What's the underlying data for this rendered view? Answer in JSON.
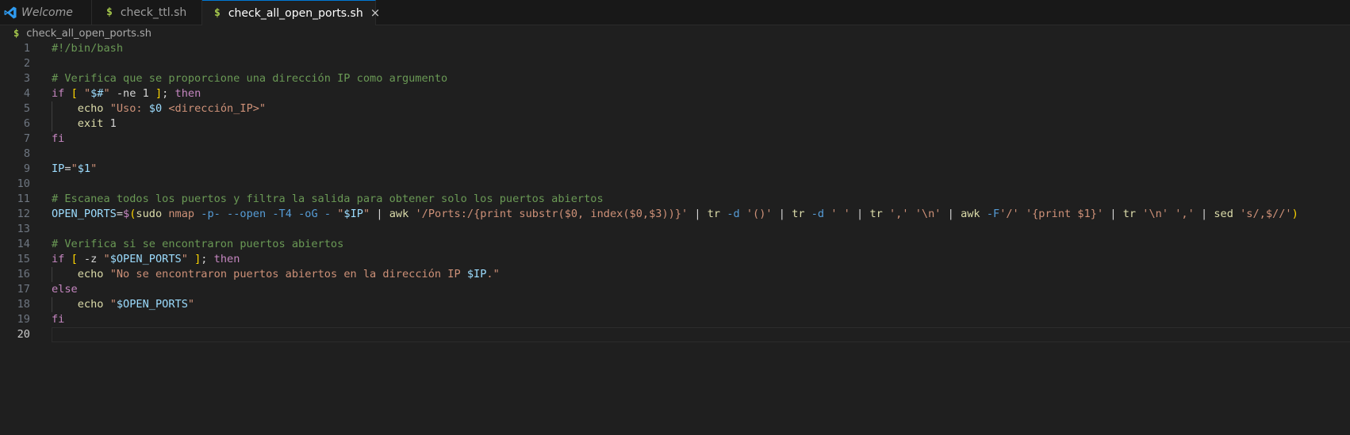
{
  "tabs": [
    {
      "label": "Welcome",
      "icon": "vscode-icon",
      "active": false
    },
    {
      "label": "check_ttl.sh",
      "icon": "dollar-icon",
      "active": false
    },
    {
      "label": "check_all_open_ports.sh",
      "icon": "dollar-icon",
      "active": true
    }
  ],
  "tab_icon_glyph": "$",
  "close_glyph": "×",
  "breadcrumb": {
    "file": "check_all_open_ports.sh",
    "icon": "dollar-icon",
    "glyph": "$"
  },
  "code_lines": [
    {
      "n": "1",
      "tokens": [
        [
          "c",
          "#!/bin/bash"
        ]
      ]
    },
    {
      "n": "2",
      "tokens": []
    },
    {
      "n": "3",
      "tokens": [
        [
          "c",
          "# Verifica que se proporcione una dirección IP como argumento"
        ]
      ]
    },
    {
      "n": "4",
      "tokens": [
        [
          "k",
          "if"
        ],
        [
          "p",
          " "
        ],
        [
          "b1",
          "["
        ],
        [
          "p",
          " "
        ],
        [
          "s",
          "\""
        ],
        [
          "v",
          "$#"
        ],
        [
          "s",
          "\""
        ],
        [
          "p",
          " -ne 1 "
        ],
        [
          "b1",
          "]"
        ],
        [
          "p",
          "; "
        ],
        [
          "k",
          "then"
        ]
      ]
    },
    {
      "n": "5",
      "guide": true,
      "tokens": [
        [
          "p",
          "    "
        ],
        [
          "f",
          "echo"
        ],
        [
          "p",
          " "
        ],
        [
          "s",
          "\"Uso: "
        ],
        [
          "v",
          "$0"
        ],
        [
          "s",
          " <dirección_IP>\""
        ]
      ]
    },
    {
      "n": "6",
      "guide": true,
      "tokens": [
        [
          "p",
          "    "
        ],
        [
          "f",
          "exit"
        ],
        [
          "p",
          " 1"
        ]
      ]
    },
    {
      "n": "7",
      "tokens": [
        [
          "k",
          "fi"
        ]
      ]
    },
    {
      "n": "8",
      "tokens": []
    },
    {
      "n": "9",
      "tokens": [
        [
          "v",
          "IP"
        ],
        [
          "p",
          "="
        ],
        [
          "s",
          "\""
        ],
        [
          "v",
          "$1"
        ],
        [
          "s",
          "\""
        ]
      ]
    },
    {
      "n": "10",
      "tokens": []
    },
    {
      "n": "11",
      "tokens": [
        [
          "c",
          "# Escanea todos los puertos y filtra la salida para obtener solo los puertos abiertos"
        ]
      ]
    },
    {
      "n": "12",
      "tokens": [
        [
          "v",
          "OPEN_PORTS"
        ],
        [
          "p",
          "="
        ],
        [
          "k",
          "$"
        ],
        [
          "b1",
          "("
        ],
        [
          "f",
          "sudo"
        ],
        [
          "p",
          " "
        ],
        [
          "s",
          "nmap"
        ],
        [
          "p",
          " "
        ],
        [
          "o",
          "-p-"
        ],
        [
          "p",
          " "
        ],
        [
          "o",
          "--open"
        ],
        [
          "p",
          " "
        ],
        [
          "o",
          "-T4"
        ],
        [
          "p",
          " "
        ],
        [
          "o",
          "-oG"
        ],
        [
          "p",
          " "
        ],
        [
          "o",
          "-"
        ],
        [
          "p",
          " "
        ],
        [
          "s",
          "\""
        ],
        [
          "v",
          "$IP"
        ],
        [
          "s",
          "\""
        ],
        [
          "p",
          " | "
        ],
        [
          "f",
          "awk"
        ],
        [
          "p",
          " "
        ],
        [
          "s",
          "'/Ports:/{print substr($0, index($0,$3))}'"
        ],
        [
          "p",
          " | "
        ],
        [
          "f",
          "tr"
        ],
        [
          "p",
          " "
        ],
        [
          "o",
          "-d"
        ],
        [
          "p",
          " "
        ],
        [
          "s",
          "'()'"
        ],
        [
          "p",
          " | "
        ],
        [
          "f",
          "tr"
        ],
        [
          "p",
          " "
        ],
        [
          "o",
          "-d"
        ],
        [
          "p",
          " "
        ],
        [
          "s",
          "' '"
        ],
        [
          "p",
          " | "
        ],
        [
          "f",
          "tr"
        ],
        [
          "p",
          " "
        ],
        [
          "s",
          "','"
        ],
        [
          "p",
          " "
        ],
        [
          "s",
          "'\\n'"
        ],
        [
          "p",
          " | "
        ],
        [
          "f",
          "awk"
        ],
        [
          "p",
          " "
        ],
        [
          "o",
          "-F"
        ],
        [
          "s",
          "'/'"
        ],
        [
          "p",
          " "
        ],
        [
          "s",
          "'{print $1}'"
        ],
        [
          "p",
          " | "
        ],
        [
          "f",
          "tr"
        ],
        [
          "p",
          " "
        ],
        [
          "s",
          "'\\n'"
        ],
        [
          "p",
          " "
        ],
        [
          "s",
          "','"
        ],
        [
          "p",
          " | "
        ],
        [
          "f",
          "sed"
        ],
        [
          "p",
          " "
        ],
        [
          "s",
          "'s/,$//'"
        ],
        [
          "b1",
          ")"
        ]
      ]
    },
    {
      "n": "13",
      "tokens": []
    },
    {
      "n": "14",
      "tokens": [
        [
          "c",
          "# Verifica si se encontraron puertos abiertos"
        ]
      ]
    },
    {
      "n": "15",
      "tokens": [
        [
          "k",
          "if"
        ],
        [
          "p",
          " "
        ],
        [
          "b1",
          "["
        ],
        [
          "p",
          " -z "
        ],
        [
          "s",
          "\""
        ],
        [
          "v",
          "$OPEN_PORTS"
        ],
        [
          "s",
          "\""
        ],
        [
          "p",
          " "
        ],
        [
          "b1",
          "]"
        ],
        [
          "p",
          "; "
        ],
        [
          "k",
          "then"
        ]
      ]
    },
    {
      "n": "16",
      "guide": true,
      "tokens": [
        [
          "p",
          "    "
        ],
        [
          "f",
          "echo"
        ],
        [
          "p",
          " "
        ],
        [
          "s",
          "\"No se encontraron puertos abiertos en la dirección IP "
        ],
        [
          "v",
          "$IP"
        ],
        [
          "s",
          ".\""
        ]
      ]
    },
    {
      "n": "17",
      "tokens": [
        [
          "k",
          "else"
        ]
      ]
    },
    {
      "n": "18",
      "guide": true,
      "tokens": [
        [
          "p",
          "    "
        ],
        [
          "f",
          "echo"
        ],
        [
          "p",
          " "
        ],
        [
          "s",
          "\""
        ],
        [
          "v",
          "$OPEN_PORTS"
        ],
        [
          "s",
          "\""
        ]
      ]
    },
    {
      "n": "19",
      "tokens": [
        [
          "k",
          "fi"
        ]
      ]
    },
    {
      "n": "20",
      "current": true,
      "tokens": []
    }
  ]
}
